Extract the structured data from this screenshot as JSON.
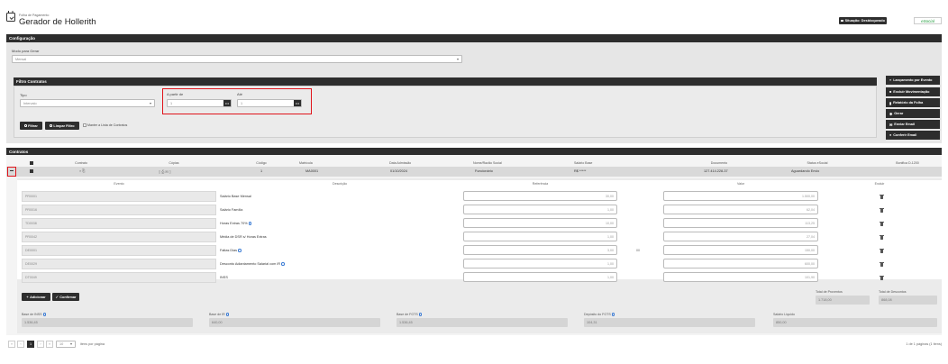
{
  "header": {
    "breadcrumb": "Folha de Pagamento",
    "title": "Gerador de Hollerith",
    "btn_situacao": "Situação: Desbloqueado",
    "btn_esocial": "eSocial"
  },
  "config": {
    "bar_title": "Configuração",
    "modo_label": "Modo para Gerar",
    "modo_value": "Mensal"
  },
  "filtro": {
    "bar_title": "Filtro Contratos",
    "tipo_label": "Tipo",
    "tipo_value": "Intervalo",
    "apartir_label": "A partir de",
    "apartir_value": "1",
    "ate_label": "Até",
    "ate_value": "1",
    "btn_filtrar": "Filtrar",
    "btn_limpar": "Limpar Filtro",
    "checkbox_label": "Manter a Lista de Contratos"
  },
  "side_buttons": [
    {
      "label": "Lançamento por Evento",
      "icon": "list-icon"
    },
    {
      "label": "Excluir Movimentação",
      "icon": "trash-icon"
    },
    {
      "label": "Relatório da Folha",
      "icon": "file-icon"
    },
    {
      "label": "Gerar",
      "icon": "gear-icon"
    },
    {
      "label": "Enviar Email",
      "icon": "mail-icon"
    },
    {
      "label": "Conferir Email",
      "icon": "users-icon"
    }
  ],
  "contratos": {
    "bar_title": "Contratos",
    "columns": [
      "Contrato",
      "Cópias",
      "Código",
      "Matrícula",
      "Data Admissão",
      "Nome/Razão Social",
      "Salário Base",
      "Documento",
      "Status eSocial",
      "Bonifica D-1200"
    ],
    "row": {
      "codigo": "1",
      "matricula": "MA0001",
      "data_admissao": "01/10/2024",
      "nome": "Funcionário",
      "salario": "R$ *****",
      "documento": "127.414.228-37",
      "status": "Aguardando Envio"
    }
  },
  "eventos": {
    "columns": [
      "Evento",
      "Descrição",
      "Referência",
      "Valor",
      "Excluir"
    ],
    "rows": [
      {
        "evento": "PR0001",
        "descricao": "Salário Base Mensal",
        "referencia": "30,00",
        "valor": "1.500,00",
        "extra": ""
      },
      {
        "evento": "PR0016",
        "descricao": "Salário Família",
        "referencia": "1,00",
        "valor": "62,04",
        "extra": ""
      },
      {
        "evento": "TD0038",
        "descricao": "Horas Extras 70%",
        "referencia": "10,00",
        "valor": "113,25",
        "extra": ""
      },
      {
        "evento": "PR0042",
        "descricao": "Média de DSR s/ Horas Extras",
        "referencia": "1,00",
        "valor": "27,04",
        "extra": ""
      },
      {
        "evento": "DE0001",
        "descricao": "Faltas Dias",
        "referencia": "3,00",
        "valor": "150,00",
        "extra": "00"
      },
      {
        "evento": "DE0029",
        "descricao": "Desconto Adiantamento Salarial com IR",
        "referencia": "1,00",
        "valor": "600,00",
        "extra": ""
      },
      {
        "evento": "DT0049",
        "descricao": "INSS",
        "referencia": "1,00",
        "valor": "101,90",
        "extra": ""
      }
    ],
    "btn_adicionar": "Adicionar",
    "btn_confirmar": "Confirmar"
  },
  "totais": {
    "proventos_label": "Total de Proventos",
    "proventos_value": "1.718,00",
    "descontos_label": "Total de Descontos",
    "descontos_value": "868,08",
    "base_inss_label": "Base de INSS",
    "base_inss_value": "1.536,45",
    "base_ir_label": "Base de IR",
    "base_ir_value": "640,00",
    "base_fgts_label": "Base de FGTS",
    "base_fgts_value": "1.536,45",
    "deposito_fgts_label": "Depósito do FGTS",
    "deposito_fgts_value": "104,31",
    "salario_liquido_label": "Salário Líquido",
    "salario_liquido_value": "850,00"
  },
  "pager": {
    "current_page": "1",
    "page_size": "10",
    "per_page_label": "itens por página",
    "summary": "1 de 1 páginas (1 itens)"
  },
  "colors": {
    "dark": "#2d2d2d",
    "highlight": "#e0141b",
    "panel": "#e6e6e6",
    "esocial": "#1f9a3a"
  }
}
